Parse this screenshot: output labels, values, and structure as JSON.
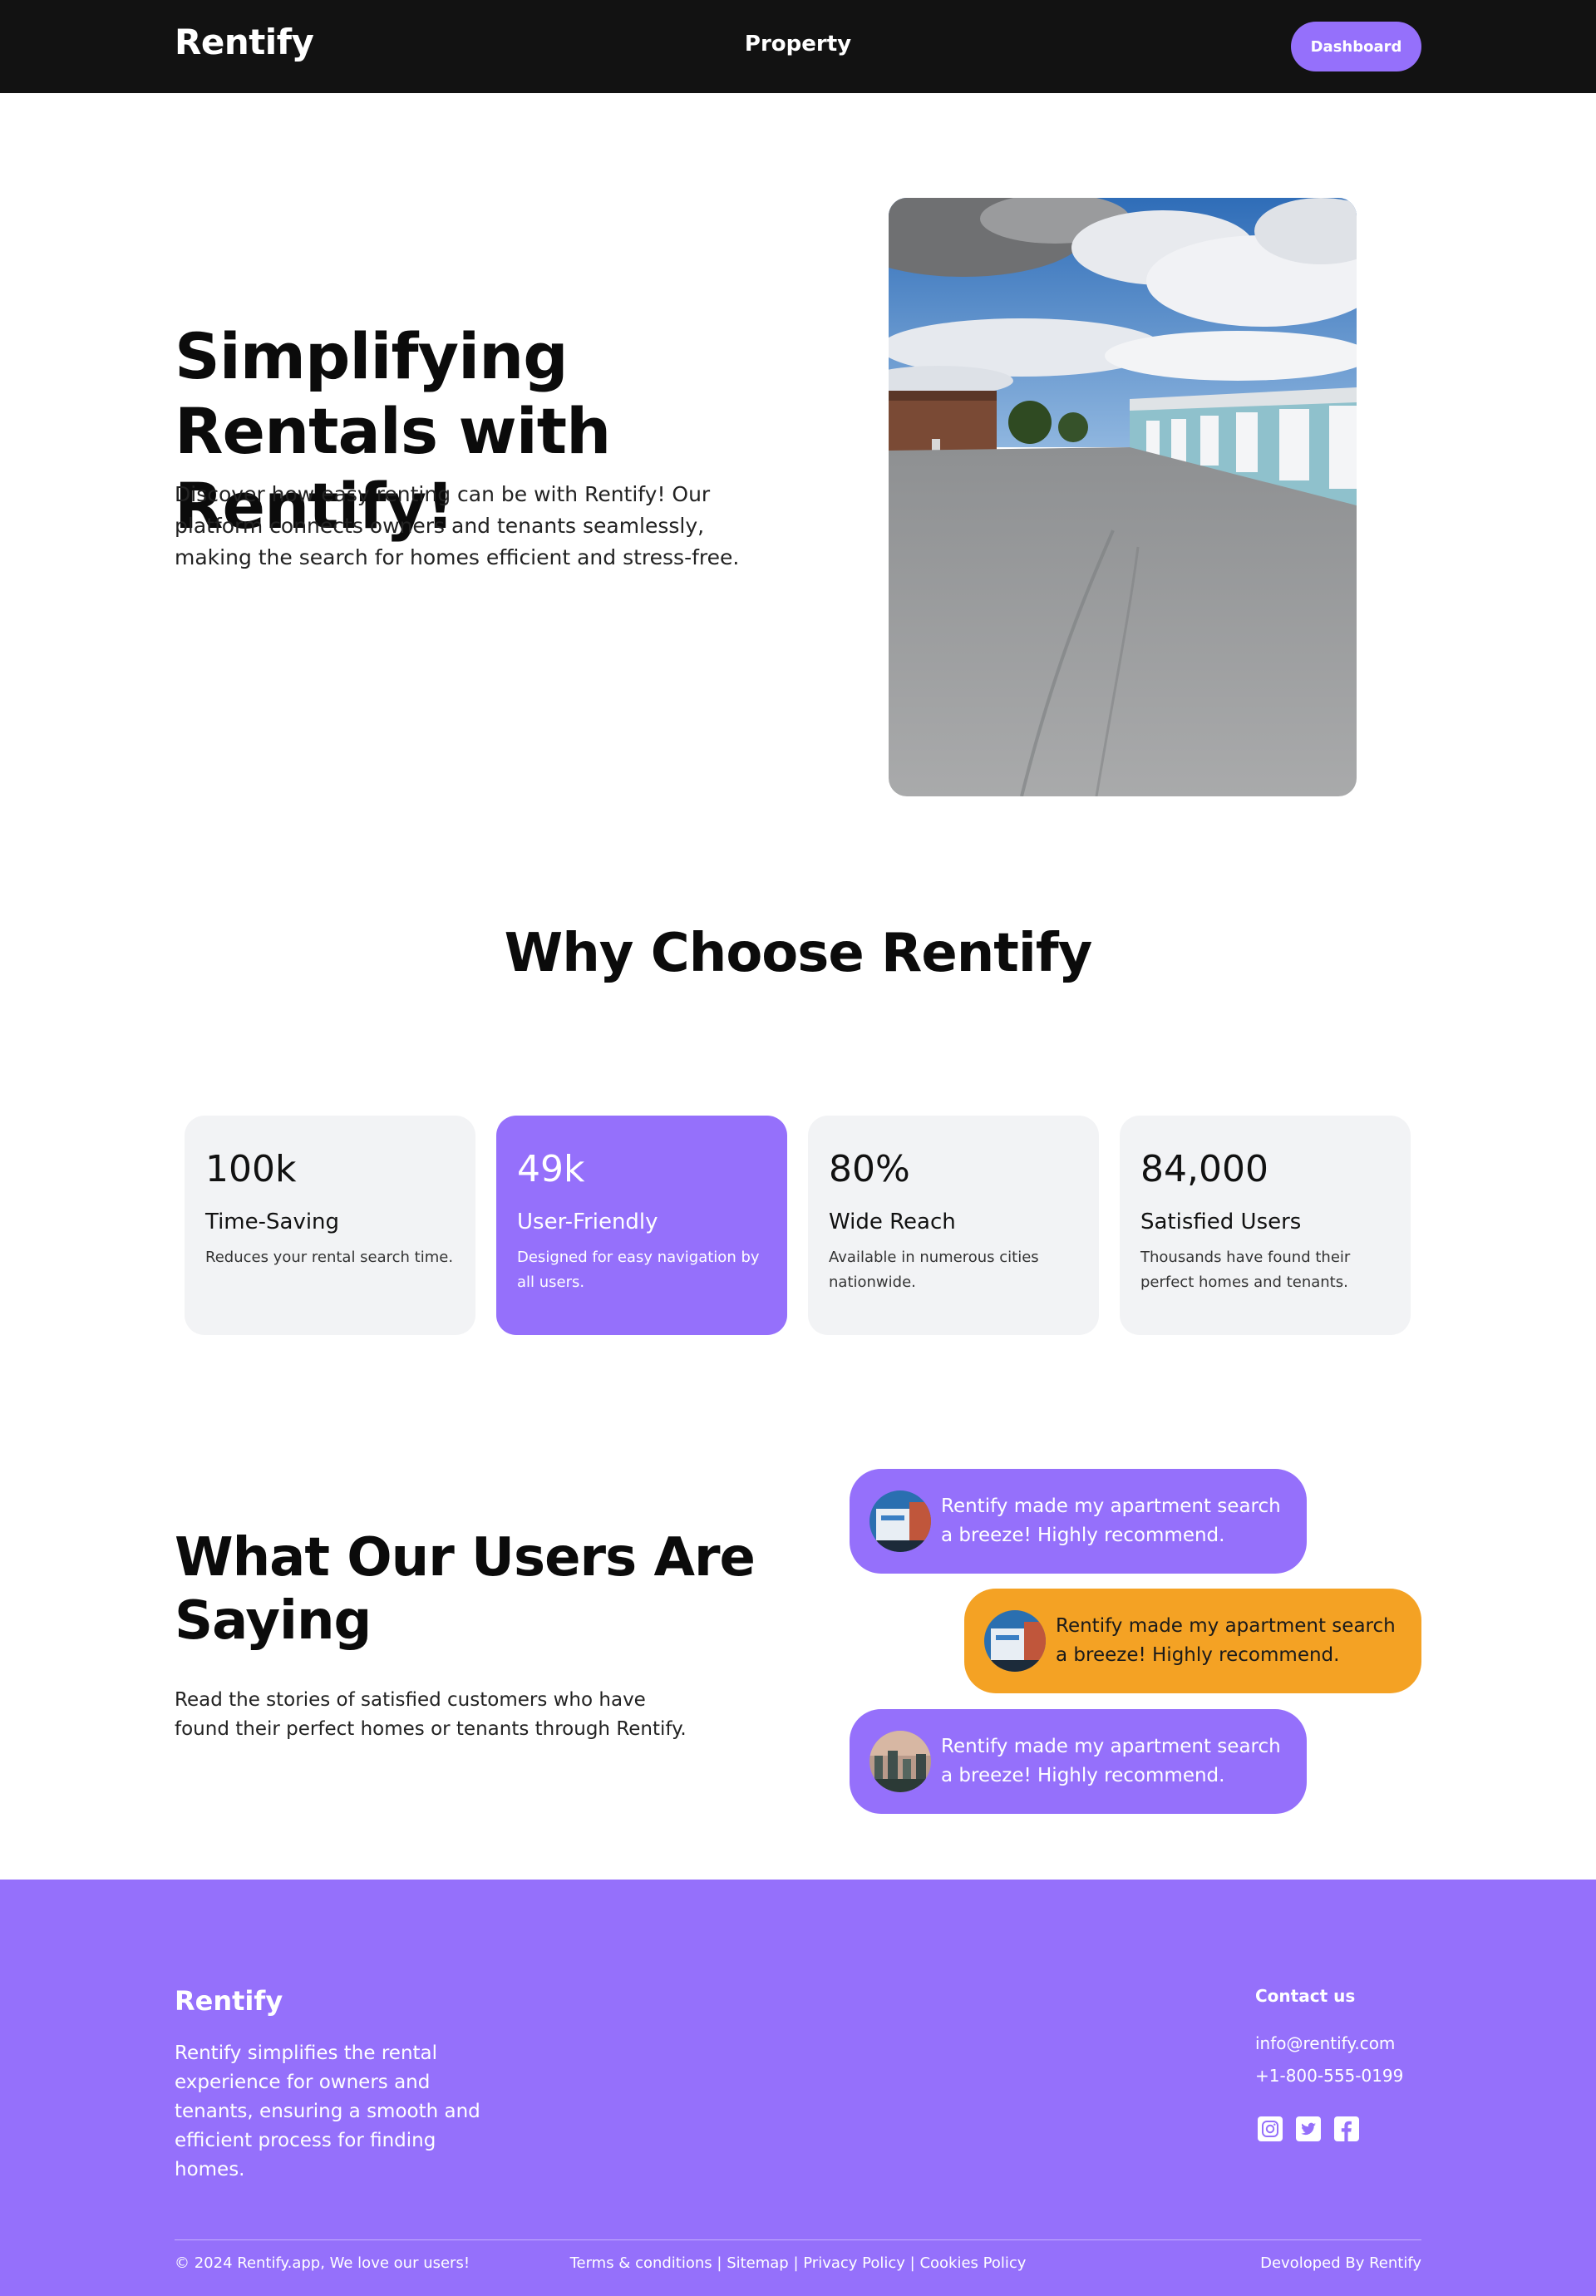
{
  "nav": {
    "brand": "Rentify",
    "link": "Property",
    "dashboard_label": "Dashboard"
  },
  "hero": {
    "title": "Simplifying Rentals with Rentify!",
    "text": "Discover how easy renting can be with Rentify! Our platform connects owners and tenants seamlessly, making the search for homes efficient and stress-free."
  },
  "why": {
    "title": "Why Choose Rentify",
    "cards": [
      {
        "num": "100k",
        "title": "Time-Saving",
        "desc": "Reduces your rental search time."
      },
      {
        "num": "49k",
        "title": "User-Friendly",
        "desc": "Designed for easy navigation by all users."
      },
      {
        "num": "80%",
        "title": "Wide Reach",
        "desc": "Available in numerous cities nationwide."
      },
      {
        "num": "84,000",
        "title": "Satisfied Users",
        "desc": "Thousands have found their perfect homes and tenants."
      }
    ]
  },
  "testimonials": {
    "title": "What Our Users Are Saying",
    "text": "Read the stories of satisfied customers who have found their perfect homes or tenants through Rentify.",
    "items": [
      {
        "text": "Rentify made my apartment search a breeze! Highly recommend."
      },
      {
        "text": "Rentify made my apartment search a breeze! Highly recommend."
      },
      {
        "text": "Rentify made my apartment search a breeze! Highly recommend."
      }
    ]
  },
  "footer": {
    "brand": "Rentify",
    "desc": "Rentify simplifies the rental experience for owners and tenants, ensuring a smooth and efficient process for finding homes.",
    "contact_title": "Contact us",
    "email": "info@rentify.com",
    "phone": "+1-800-555-0199",
    "social_icons": [
      "instagram-icon",
      "twitter-icon",
      "facebook-icon"
    ],
    "copyright": "© 2024 Rentify.app, We love our users!",
    "links": [
      "Terms & conditions",
      "Sitemap",
      "Privacy Policy",
      "Cookies Policy"
    ],
    "separator": " | ",
    "developed": "Devoloped By Rentify"
  },
  "colors": {
    "accent": "#9570fb",
    "nav_bg": "#121212",
    "orange": "#f4a224",
    "card_bg": "#f2f3f5"
  }
}
